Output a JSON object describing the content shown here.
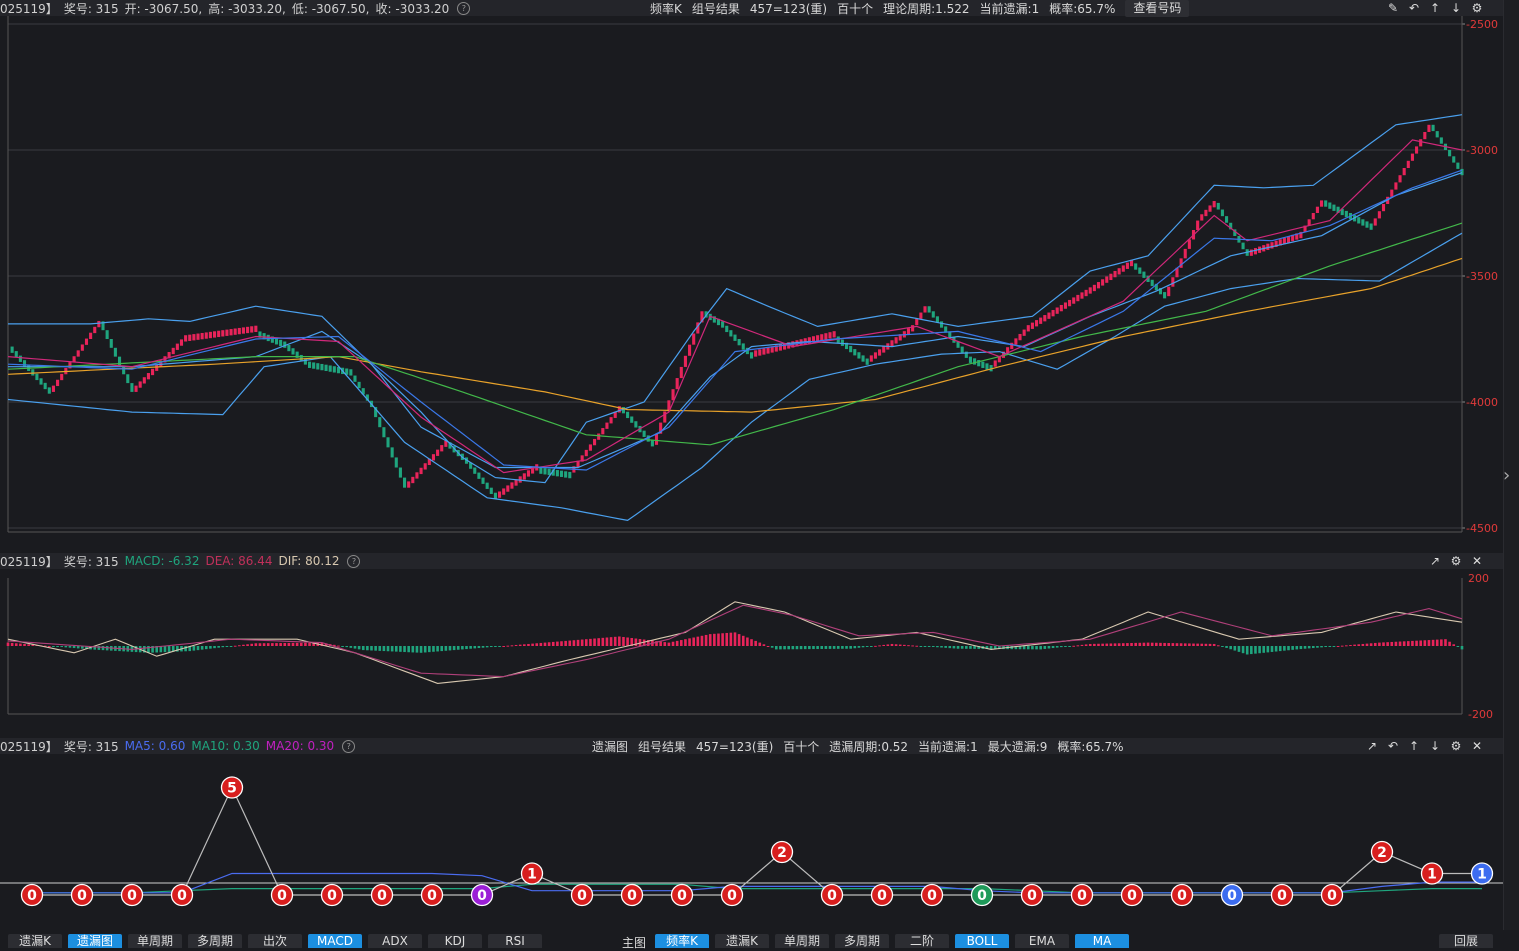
{
  "main_header": {
    "prefix": "025119】",
    "award": "奖号: 315",
    "open": "开: -3067.50,",
    "high": "高: -3033.20,",
    "low": "低: -3067.50,",
    "close": "收: -3033.20",
    "center": [
      "频率K",
      "组号结果",
      "457=123(重)",
      "百十个",
      "理论周期:1.522",
      "当前遗漏:1",
      "概率:65.7%"
    ],
    "view_button": "查看号码"
  },
  "macd_header": {
    "prefix": "025119】",
    "award": "奖号: 315",
    "macd_label": "MACD: -6.32",
    "dea_label": "DEA: 86.44",
    "dif_label": "DIF: 80.12"
  },
  "omit_header": {
    "prefix": "025119】",
    "award": "奖号: 315",
    "ma5": "MA5: 0.60",
    "ma10": "MA10: 0.30",
    "ma20": "MA20: 0.30",
    "center": [
      "遗漏图",
      "组号结果",
      "457=123(重)",
      "百十个",
      "遗漏周期:0.52",
      "当前遗漏:1",
      "最大遗漏:9",
      "概率:65.7%"
    ]
  },
  "colors": {
    "up": "#e8245a",
    "down": "#1fa57e",
    "boll": "#4aa0ee",
    "ma_orange": "#e8a22a",
    "ma_green": "#42b84a",
    "ma_pink": "#d0287a",
    "ma_blue": "#3a78e8"
  },
  "bottom_tabs_left": [
    {
      "label": "遗漏K",
      "active": false
    },
    {
      "label": "遗漏图",
      "active": true
    },
    {
      "label": "单周期",
      "active": false
    },
    {
      "label": "多周期",
      "active": false
    },
    {
      "label": "出次",
      "active": false
    },
    {
      "label": "MACD",
      "active": true
    },
    {
      "label": "ADX",
      "active": false
    },
    {
      "label": "KDJ",
      "active": false
    },
    {
      "label": "RSI",
      "active": false
    }
  ],
  "bottom_main_label": "主图",
  "bottom_tabs_right": [
    {
      "label": "频率K",
      "active": true
    },
    {
      "label": "遗漏K",
      "active": false
    },
    {
      "label": "单周期",
      "active": false
    },
    {
      "label": "多周期",
      "active": false
    },
    {
      "label": "二阶",
      "active": false
    },
    {
      "label": "BOLL",
      "active": true
    },
    {
      "label": "EMA",
      "active": false
    },
    {
      "label": "MA",
      "active": true
    }
  ],
  "bottom_far_right": "回展",
  "chart_data": [
    {
      "type": "candlestick",
      "name": "频率K",
      "y_ticks": [
        "-2500",
        "-3000",
        "-3500",
        "-4000",
        "-4500"
      ],
      "ylim": [
        -4500,
        -2500
      ],
      "waypoints": [
        [
          0,
          -3780
        ],
        [
          10,
          -3960
        ],
        [
          22,
          -3680
        ],
        [
          30,
          -3960
        ],
        [
          42,
          -3760
        ],
        [
          60,
          -3720
        ],
        [
          66,
          -3760
        ],
        [
          72,
          -3840
        ],
        [
          82,
          -3870
        ],
        [
          88,
          -4020
        ],
        [
          96,
          -4340
        ],
        [
          106,
          -4160
        ],
        [
          110,
          -4220
        ],
        [
          118,
          -4380
        ],
        [
          128,
          -4260
        ],
        [
          136,
          -4280
        ],
        [
          148,
          -4020
        ],
        [
          156,
          -4170
        ],
        [
          168,
          -3640
        ],
        [
          172,
          -3680
        ],
        [
          180,
          -3820
        ],
        [
          190,
          -3780
        ],
        [
          200,
          -3740
        ],
        [
          208,
          -3840
        ],
        [
          218,
          -3720
        ],
        [
          222,
          -3620
        ],
        [
          232,
          -3820
        ],
        [
          238,
          -3860
        ],
        [
          246,
          -3720
        ],
        [
          262,
          -3560
        ],
        [
          272,
          -3450
        ],
        [
          280,
          -3580
        ],
        [
          288,
          -3280
        ],
        [
          292,
          -3210
        ],
        [
          300,
          -3420
        ],
        [
          312,
          -3350
        ],
        [
          318,
          -3200
        ],
        [
          330,
          -3300
        ],
        [
          344,
          -2900
        ],
        [
          352,
          -3100
        ]
      ],
      "boll": {
        "upper": [
          [
            0,
            -3690
          ],
          [
            20,
            -3690
          ],
          [
            34,
            -3670
          ],
          [
            44,
            -3680
          ],
          [
            60,
            -3620
          ],
          [
            76,
            -3660
          ],
          [
            86,
            -3820
          ],
          [
            100,
            -4040
          ],
          [
            110,
            -4220
          ],
          [
            118,
            -4300
          ],
          [
            130,
            -4320
          ],
          [
            140,
            -4080
          ],
          [
            154,
            -4000
          ],
          [
            166,
            -3720
          ],
          [
            174,
            -3550
          ],
          [
            184,
            -3620
          ],
          [
            196,
            -3700
          ],
          [
            214,
            -3650
          ],
          [
            230,
            -3700
          ],
          [
            248,
            -3660
          ],
          [
            262,
            -3480
          ],
          [
            276,
            -3420
          ],
          [
            292,
            -3140
          ],
          [
            304,
            -3150
          ],
          [
            316,
            -3140
          ],
          [
            336,
            -2900
          ],
          [
            352,
            -2860
          ]
        ],
        "mid": [
          [
            0,
            -3860
          ],
          [
            30,
            -3860
          ],
          [
            60,
            -3820
          ],
          [
            76,
            -3720
          ],
          [
            88,
            -3850
          ],
          [
            100,
            -4100
          ],
          [
            118,
            -4260
          ],
          [
            138,
            -4260
          ],
          [
            158,
            -4120
          ],
          [
            170,
            -3900
          ],
          [
            180,
            -3780
          ],
          [
            194,
            -3760
          ],
          [
            214,
            -3780
          ],
          [
            230,
            -3740
          ],
          [
            246,
            -3780
          ],
          [
            262,
            -3660
          ],
          [
            278,
            -3560
          ],
          [
            296,
            -3420
          ],
          [
            318,
            -3340
          ],
          [
            336,
            -3180
          ],
          [
            352,
            -3090
          ]
        ],
        "lower": [
          [
            0,
            -3990
          ],
          [
            30,
            -4040
          ],
          [
            52,
            -4050
          ],
          [
            62,
            -3860
          ],
          [
            78,
            -3820
          ],
          [
            96,
            -4160
          ],
          [
            116,
            -4380
          ],
          [
            134,
            -4420
          ],
          [
            150,
            -4470
          ],
          [
            168,
            -4260
          ],
          [
            180,
            -4080
          ],
          [
            194,
            -3910
          ],
          [
            210,
            -3850
          ],
          [
            226,
            -3810
          ],
          [
            240,
            -3800
          ],
          [
            254,
            -3870
          ],
          [
            268,
            -3740
          ],
          [
            280,
            -3620
          ],
          [
            296,
            -3550
          ],
          [
            312,
            -3510
          ],
          [
            332,
            -3520
          ],
          [
            352,
            -3330
          ]
        ]
      },
      "ma": {
        "orange": [
          [
            0,
            -3890
          ],
          [
            50,
            -3850
          ],
          [
            80,
            -3820
          ],
          [
            100,
            -3880
          ],
          [
            130,
            -3960
          ],
          [
            150,
            -4030
          ],
          [
            180,
            -4040
          ],
          [
            210,
            -3990
          ],
          [
            240,
            -3860
          ],
          [
            270,
            -3740
          ],
          [
            300,
            -3640
          ],
          [
            330,
            -3550
          ],
          [
            352,
            -3430
          ]
        ],
        "green": [
          [
            0,
            -3870
          ],
          [
            60,
            -3820
          ],
          [
            84,
            -3820
          ],
          [
            110,
            -3960
          ],
          [
            140,
            -4130
          ],
          [
            170,
            -4170
          ],
          [
            200,
            -4030
          ],
          [
            230,
            -3860
          ],
          [
            260,
            -3740
          ],
          [
            290,
            -3640
          ],
          [
            320,
            -3460
          ],
          [
            352,
            -3290
          ]
        ],
        "pink": [
          [
            0,
            -3820
          ],
          [
            30,
            -3860
          ],
          [
            60,
            -3740
          ],
          [
            80,
            -3760
          ],
          [
            100,
            -4060
          ],
          [
            120,
            -4280
          ],
          [
            140,
            -4230
          ],
          [
            160,
            -4040
          ],
          [
            170,
            -3660
          ],
          [
            190,
            -3780
          ],
          [
            220,
            -3700
          ],
          [
            240,
            -3820
          ],
          [
            270,
            -3600
          ],
          [
            292,
            -3260
          ],
          [
            300,
            -3360
          ],
          [
            320,
            -3280
          ],
          [
            340,
            -2960
          ],
          [
            352,
            -3000
          ]
        ],
        "blue": [
          [
            0,
            -3850
          ],
          [
            30,
            -3870
          ],
          [
            60,
            -3750
          ],
          [
            80,
            -3740
          ],
          [
            100,
            -4000
          ],
          [
            120,
            -4250
          ],
          [
            140,
            -4270
          ],
          [
            160,
            -4100
          ],
          [
            176,
            -3800
          ],
          [
            200,
            -3750
          ],
          [
            230,
            -3720
          ],
          [
            250,
            -3800
          ],
          [
            270,
            -3640
          ],
          [
            292,
            -3350
          ],
          [
            306,
            -3360
          ],
          [
            320,
            -3300
          ],
          [
            340,
            -3150
          ],
          [
            352,
            -3080
          ]
        ]
      }
    },
    {
      "type": "macd",
      "name": "MACD",
      "y_ticks": [
        "200",
        "-200"
      ],
      "ylim": [
        -200,
        200
      ],
      "hist": [
        [
          0,
          10
        ],
        [
          20,
          -10
        ],
        [
          34,
          -20
        ],
        [
          44,
          -15
        ],
        [
          60,
          8
        ],
        [
          76,
          10
        ],
        [
          86,
          -12
        ],
        [
          100,
          -20
        ],
        [
          114,
          -6
        ],
        [
          130,
          10
        ],
        [
          148,
          28
        ],
        [
          160,
          10
        ],
        [
          170,
          35
        ],
        [
          176,
          40
        ],
        [
          186,
          -10
        ],
        [
          204,
          -8
        ],
        [
          214,
          6
        ],
        [
          230,
          -8
        ],
        [
          250,
          -10
        ],
        [
          262,
          6
        ],
        [
          276,
          10
        ],
        [
          292,
          6
        ],
        [
          300,
          -25
        ],
        [
          312,
          -10
        ],
        [
          332,
          10
        ],
        [
          348,
          20
        ],
        [
          352,
          -10
        ]
      ],
      "dif": [
        [
          0,
          20
        ],
        [
          16,
          -20
        ],
        [
          26,
          20
        ],
        [
          36,
          -30
        ],
        [
          50,
          20
        ],
        [
          70,
          20
        ],
        [
          84,
          -20
        ],
        [
          104,
          -110
        ],
        [
          120,
          -90
        ],
        [
          136,
          -40
        ],
        [
          150,
          0
        ],
        [
          164,
          40
        ],
        [
          176,
          130
        ],
        [
          188,
          100
        ],
        [
          204,
          20
        ],
        [
          220,
          40
        ],
        [
          238,
          -10
        ],
        [
          260,
          20
        ],
        [
          276,
          100
        ],
        [
          298,
          20
        ],
        [
          318,
          40
        ],
        [
          336,
          100
        ],
        [
          352,
          70
        ]
      ],
      "dea": [
        [
          0,
          15
        ],
        [
          30,
          -10
        ],
        [
          54,
          20
        ],
        [
          76,
          10
        ],
        [
          100,
          -80
        ],
        [
          120,
          -90
        ],
        [
          140,
          -40
        ],
        [
          160,
          20
        ],
        [
          178,
          120
        ],
        [
          190,
          90
        ],
        [
          206,
          30
        ],
        [
          224,
          40
        ],
        [
          240,
          0
        ],
        [
          262,
          20
        ],
        [
          284,
          100
        ],
        [
          306,
          30
        ],
        [
          330,
          70
        ],
        [
          344,
          110
        ],
        [
          352,
          80
        ]
      ]
    },
    {
      "type": "line",
      "name": "遗漏图",
      "x_count": 30,
      "values": [
        0,
        0,
        0,
        0,
        5,
        0,
        0,
        0,
        0,
        0,
        1,
        0,
        0,
        0,
        0,
        2,
        0,
        0,
        0,
        0,
        0,
        0,
        0,
        0,
        0,
        0,
        0,
        2,
        1,
        1
      ],
      "point_colors": [
        "#d81e1e",
        "#d81e1e",
        "#d81e1e",
        "#d81e1e",
        "#d81e1e",
        "#d81e1e",
        "#d81e1e",
        "#d81e1e",
        "#d81e1e",
        "#9b1fd6",
        "#d81e1e",
        "#d81e1e",
        "#d81e1e",
        "#d81e1e",
        "#d81e1e",
        "#d81e1e",
        "#d81e1e",
        "#d81e1e",
        "#d81e1e",
        "#1f9a5a",
        "#d81e1e",
        "#d81e1e",
        "#d81e1e",
        "#d81e1e",
        "#3c6cf0",
        "#d81e1e",
        "#d81e1e",
        "#d81e1e",
        "#d81e1e",
        "#3c6cf0"
      ],
      "ma5": [
        0.1,
        0.1,
        0.1,
        0.1,
        1,
        1,
        1,
        1,
        1,
        0.9,
        0.2,
        0.2,
        0.2,
        0.2,
        0.4,
        0.4,
        0.4,
        0.4,
        0.4,
        0.2,
        0.1,
        0.1,
        0.1,
        0.1,
        0.1,
        0.1,
        0.1,
        0.4,
        0.6,
        0.6
      ],
      "ma10": [
        0.1,
        0.1,
        0.1,
        0.2,
        0.3,
        0.3,
        0.3,
        0.3,
        0.3,
        0.3,
        0.5,
        0.5,
        0.5,
        0.5,
        0.3,
        0.3,
        0.3,
        0.3,
        0.3,
        0.3,
        0.2,
        0.1,
        0.1,
        0.1,
        0.1,
        0.1,
        0.1,
        0.2,
        0.3,
        0.3
      ]
    }
  ]
}
